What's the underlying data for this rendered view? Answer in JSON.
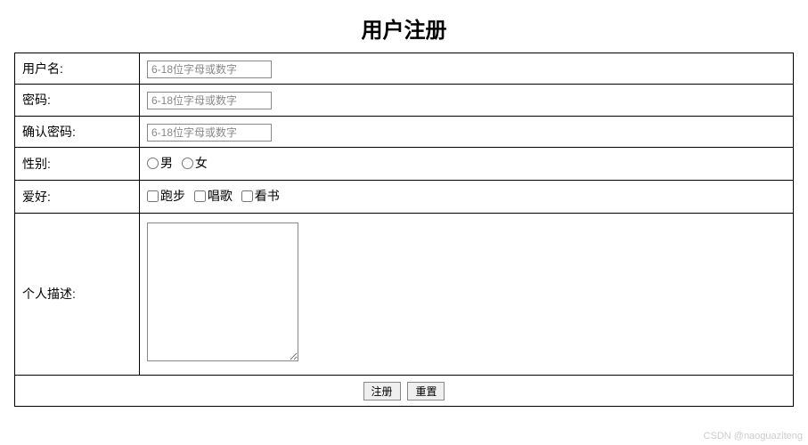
{
  "form": {
    "title": "用户注册",
    "username": {
      "label": "用户名:",
      "placeholder": "6-18位字母或数字"
    },
    "password": {
      "label": "密码:",
      "placeholder": "6-18位字母或数字"
    },
    "confirm_password": {
      "label": "确认密码:",
      "placeholder": "6-18位字母或数字"
    },
    "gender": {
      "label": "性别:",
      "options": {
        "male": "男",
        "female": "女"
      }
    },
    "hobby": {
      "label": "爱好:",
      "options": {
        "running": "跑步",
        "singing": "唱歌",
        "reading": "看书"
      }
    },
    "description": {
      "label": "个人描述:"
    },
    "buttons": {
      "submit": "注册",
      "reset": "重置"
    }
  },
  "watermark": "CSDN @naoguaziteng"
}
